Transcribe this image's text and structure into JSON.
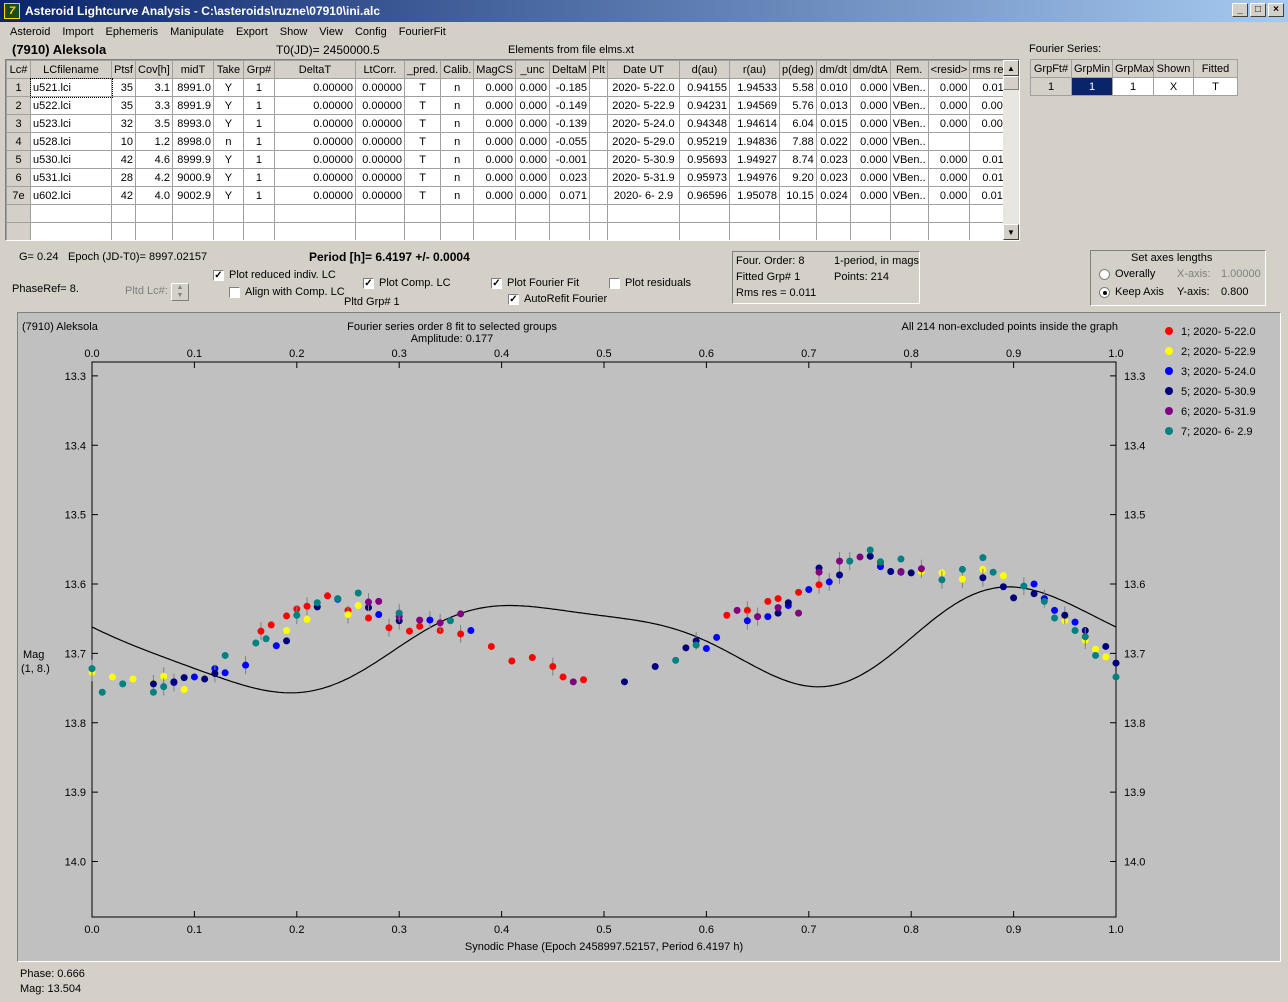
{
  "window": {
    "title": "Asteroid Lightcurve Analysis - C:\\asteroids\\ruzne\\07910\\ini.alc",
    "icon_glyph": "7",
    "minimize_icon": "minimize-icon",
    "maximize_icon": "maximize-icon",
    "close_icon": "close-icon"
  },
  "menu": [
    "Asteroid",
    "Import",
    "Ephemeris",
    "Manipulate",
    "Export",
    "Show",
    "View",
    "Config",
    "FourierFit"
  ],
  "header": {
    "asteroid": "(7910) Aleksola",
    "t0": "T0(JD)= 2450000.5",
    "elements": "Elements from file elms.xt"
  },
  "lc_table": {
    "columns": [
      "Lc#",
      "LCfilename",
      "Ptsf",
      "Cov[h]",
      "midT",
      "Take",
      "Grp#",
      "DeltaT",
      "LtCorr.",
      "_pred.",
      "Calib.",
      "MagCS",
      "_unc",
      "DeltaM",
      "Plt",
      "Date UT",
      "d(au)",
      "r(au)",
      "p(deg)",
      "dm/dt",
      "dm/dtA",
      "Rem.",
      "<resid>",
      "rms res"
    ],
    "rows": [
      [
        "1",
        "u521.lci",
        "35",
        "3.1",
        "8991.0",
        "Y",
        "1",
        "0.00000",
        "0.00000",
        "T",
        "n",
        "0.000",
        "0.000",
        "-0.185",
        "",
        "2020- 5-22.0",
        "0.94155",
        "1.94533",
        "5.58",
        "0.010",
        "0.000",
        "VBen..",
        "0.000",
        "0.011"
      ],
      [
        "2",
        "u522.lci",
        "35",
        "3.3",
        "8991.9",
        "Y",
        "1",
        "0.00000",
        "0.00000",
        "T",
        "n",
        "0.000",
        "0.000",
        "-0.149",
        "",
        "2020- 5-22.9",
        "0.94231",
        "1.94569",
        "5.76",
        "0.013",
        "0.000",
        "VBen..",
        "0.000",
        "0.007"
      ],
      [
        "3",
        "u523.lci",
        "32",
        "3.5",
        "8993.0",
        "Y",
        "1",
        "0.00000",
        "0.00000",
        "T",
        "n",
        "0.000",
        "0.000",
        "-0.139",
        "",
        "2020- 5-24.0",
        "0.94348",
        "1.94614",
        "6.04",
        "0.015",
        "0.000",
        "VBen..",
        "0.000",
        "0.008"
      ],
      [
        "4",
        "u528.lci",
        "10",
        "1.2",
        "8998.0",
        "n",
        "1",
        "0.00000",
        "0.00000",
        "T",
        "n",
        "0.000",
        "0.000",
        "-0.055",
        "",
        "2020- 5-29.0",
        "0.95219",
        "1.94836",
        "7.88",
        "0.022",
        "0.000",
        "VBen..",
        "",
        ""
      ],
      [
        "5",
        "u530.lci",
        "42",
        "4.6",
        "8999.9",
        "Y",
        "1",
        "0.00000",
        "0.00000",
        "T",
        "n",
        "0.000",
        "0.000",
        "-0.001",
        "",
        "2020- 5-30.9",
        "0.95693",
        "1.94927",
        "8.74",
        "0.023",
        "0.000",
        "VBen..",
        "0.000",
        "0.011"
      ],
      [
        "6",
        "u531.lci",
        "28",
        "4.2",
        "9000.9",
        "Y",
        "1",
        "0.00000",
        "0.00000",
        "T",
        "n",
        "0.000",
        "0.000",
        "0.023",
        "",
        "2020- 5-31.9",
        "0.95973",
        "1.94976",
        "9.20",
        "0.023",
        "0.000",
        "VBen..",
        "0.000",
        "0.011"
      ],
      [
        "7e",
        "u602.lci",
        "42",
        "4.0",
        "9002.9",
        "Y",
        "1",
        "0.00000",
        "0.00000",
        "T",
        "n",
        "0.000",
        "0.000",
        "0.071",
        "",
        "2020- 6- 2.9",
        "0.96596",
        "1.95078",
        "10.15",
        "0.024",
        "0.000",
        "VBen..",
        "0.000",
        "0.014"
      ]
    ]
  },
  "fourier_series": {
    "label": "Fourier Series:",
    "columns": [
      "GrpFt#",
      "GrpMin",
      "GrpMax",
      "Shown",
      "Fitted"
    ],
    "row": [
      "1",
      "1",
      "1",
      "X",
      "T"
    ]
  },
  "controls": {
    "g_value": "G= 0.24",
    "epoch": "Epoch (JD-T0)= 8997.02157",
    "period": "Period [h]= 6.4197 +/- 0.0004",
    "phaseref": "PhaseRef= 8.",
    "pltd_lc": "Pltd Lc#:",
    "pltd_grp": "Pltd Grp#  1",
    "plot_reduced": "Plot reduced indiv. LC",
    "align_comp": "Align with Comp. LC",
    "plot_comp": "Plot Comp. LC",
    "plot_fourier": "Plot Fourier Fit",
    "autorefit": "AutoRefit Fourier",
    "plot_residuals": "Plot residuals",
    "check_glyph": "✓"
  },
  "info_box": {
    "four_order": "Four. Order:  8",
    "one_period": "1-period, in mags",
    "fitted_grp": "Fitted Grp# 1",
    "points": "Points: 214",
    "rms": "Rms res     = 0.011"
  },
  "axes_box": {
    "title": "Set axes lengths",
    "overally": "Overally",
    "keep_axis": "Keep Axis",
    "xaxis_label": "X-axis:",
    "xaxis_value": "1.00000",
    "yaxis_label": "Y-axis:",
    "yaxis_value": "0.800"
  },
  "plot": {
    "name": "(7910) Aleksola",
    "fit_title": "Fourier series order 8 fit to selected groups",
    "amplitude": "Amplitude: 0.177",
    "points_note": "All 214 non-excluded points inside the graph",
    "ylabel": "Mag",
    "ylabel2": "(1, 8.)",
    "xlabel": "Synodic Phase (Epoch 2458997.52157, Period 6.4197 h)",
    "phase_readout": "Phase:  0.666",
    "mag_readout": "Mag:    13.504"
  },
  "chart_data": {
    "type": "scatter",
    "title": "Fourier series order 8 fit to selected groups",
    "subtitle": "Amplitude: 0.177",
    "xlabel": "Synodic Phase (Epoch 2458997.52157, Period 6.4197 h)",
    "ylabel": "Mag",
    "xlim": [
      0,
      1
    ],
    "ylim": [
      14.08,
      13.28
    ],
    "xticks": [
      "0.0",
      "0.1",
      "0.2",
      "0.3",
      "0.4",
      "0.5",
      "0.6",
      "0.7",
      "0.8",
      "0.9",
      "1.0"
    ],
    "yticks": [
      "13.3",
      "13.4",
      "13.5",
      "13.6",
      "13.7",
      "13.8",
      "13.9",
      "14.0"
    ],
    "legend_position": "right",
    "series": [
      {
        "name": "1; 2020- 5-22.0",
        "color": "#ff0000",
        "x": [
          0.165,
          0.175,
          0.19,
          0.2,
          0.21,
          0.23,
          0.25,
          0.27,
          0.29,
          0.31,
          0.32,
          0.34,
          0.36,
          0.39,
          0.41,
          0.43,
          0.45,
          0.46,
          0.48,
          0.62,
          0.64,
          0.66,
          0.67,
          0.69,
          0.71
        ],
        "y": [
          13.668,
          13.659,
          13.646,
          13.636,
          13.632,
          13.617,
          13.638,
          13.649,
          13.663,
          13.668,
          13.661,
          13.667,
          13.672,
          13.69,
          13.711,
          13.706,
          13.719,
          13.734,
          13.738,
          13.645,
          13.638,
          13.625,
          13.621,
          13.612,
          13.601
        ]
      },
      {
        "name": "2; 2020- 5-22.9",
        "color": "#ffff00",
        "x": [
          0.0,
          0.02,
          0.04,
          0.06,
          0.07,
          0.09,
          0.19,
          0.21,
          0.25,
          0.26,
          0.81,
          0.83,
          0.85,
          0.87,
          0.89,
          0.95,
          0.97,
          0.98,
          0.99
        ],
        "y": [
          13.727,
          13.734,
          13.737,
          13.743,
          13.733,
          13.752,
          13.667,
          13.651,
          13.644,
          13.631,
          13.582,
          13.584,
          13.593,
          13.579,
          13.588,
          13.653,
          13.681,
          13.694,
          13.705
        ]
      },
      {
        "name": "3; 2020- 5-24.0",
        "color": "#0000ff",
        "x": [
          0.08,
          0.1,
          0.12,
          0.13,
          0.15,
          0.18,
          0.24,
          0.28,
          0.33,
          0.37,
          0.6,
          0.61,
          0.64,
          0.66,
          0.68,
          0.7,
          0.72,
          0.77,
          0.79,
          0.92,
          0.93,
          0.94,
          0.96
        ],
        "y": [
          13.742,
          13.734,
          13.722,
          13.728,
          13.717,
          13.689,
          13.622,
          13.644,
          13.652,
          13.667,
          13.693,
          13.677,
          13.653,
          13.647,
          13.631,
          13.608,
          13.597,
          13.575,
          13.583,
          13.6,
          13.621,
          13.638,
          13.655
        ]
      },
      {
        "name": "5; 2020- 5-30.9",
        "color": "#00007a",
        "x": [
          0.06,
          0.08,
          0.09,
          0.11,
          0.12,
          0.19,
          0.22,
          0.27,
          0.3,
          0.52,
          0.55,
          0.58,
          0.59,
          0.67,
          0.68,
          0.71,
          0.73,
          0.76,
          0.78,
          0.8,
          0.87,
          0.89,
          0.9,
          0.92,
          0.95,
          0.97,
          0.99,
          1.0
        ],
        "y": [
          13.744,
          13.741,
          13.735,
          13.737,
          13.729,
          13.682,
          13.633,
          13.634,
          13.653,
          13.741,
          13.719,
          13.692,
          13.682,
          13.642,
          13.627,
          13.577,
          13.587,
          13.56,
          13.582,
          13.584,
          13.591,
          13.604,
          13.62,
          13.614,
          13.645,
          13.667,
          13.69,
          13.714
        ]
      },
      {
        "name": "6; 2020- 5-31.9",
        "color": "#800080",
        "x": [
          0.27,
          0.28,
          0.3,
          0.32,
          0.34,
          0.36,
          0.47,
          0.63,
          0.65,
          0.67,
          0.69,
          0.71,
          0.73,
          0.75,
          0.77,
          0.79,
          0.81
        ],
        "y": [
          13.626,
          13.625,
          13.647,
          13.652,
          13.656,
          13.643,
          13.741,
          13.638,
          13.647,
          13.634,
          13.642,
          13.583,
          13.567,
          13.561,
          13.569,
          13.582,
          13.578
        ]
      },
      {
        "name": "7; 2020- 6- 2.9",
        "color": "#008080",
        "x": [
          0.0,
          0.01,
          0.03,
          0.06,
          0.07,
          0.13,
          0.16,
          0.17,
          0.2,
          0.22,
          0.24,
          0.26,
          0.3,
          0.35,
          0.57,
          0.59,
          0.74,
          0.76,
          0.77,
          0.79,
          0.83,
          0.85,
          0.87,
          0.88,
          0.91,
          0.93,
          0.94,
          0.96,
          0.97,
          0.98,
          1.0
        ],
        "y": [
          13.722,
          13.756,
          13.744,
          13.756,
          13.748,
          13.703,
          13.685,
          13.679,
          13.645,
          13.627,
          13.621,
          13.613,
          13.642,
          13.653,
          13.71,
          13.688,
          13.567,
          13.551,
          13.568,
          13.564,
          13.594,
          13.579,
          13.562,
          13.583,
          13.603,
          13.625,
          13.649,
          13.667,
          13.676,
          13.703,
          13.734
        ]
      }
    ],
    "fit": {
      "color": "#000000",
      "mean": 13.682,
      "terms": [
        [
          0.0,
          0.0
        ],
        [
          0.005,
          0.012
        ],
        [
          -0.04,
          0.048
        ],
        [
          0.003,
          0.01
        ],
        [
          0.012,
          -0.006
        ]
      ]
    }
  }
}
